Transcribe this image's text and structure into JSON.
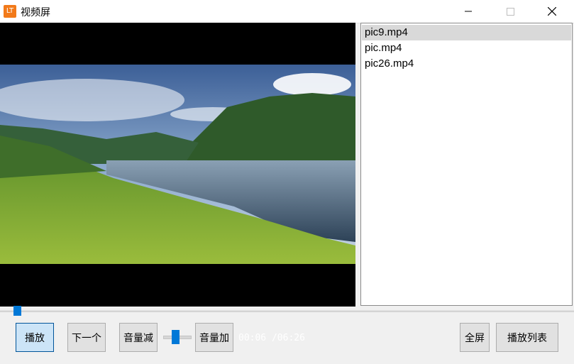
{
  "window": {
    "app_icon_text": "LT",
    "title": "视频屏",
    "controls": [
      "minimize-icon",
      "maximize-icon",
      "close-icon"
    ]
  },
  "playlist": {
    "items": [
      "pic9.mp4",
      "pic.mp4",
      "pic26.mp4"
    ],
    "selected_index": 0
  },
  "controls": {
    "play_label": "播放",
    "next_label": "下一个",
    "vol_down_label": "音量减",
    "vol_up_label": "音量加",
    "time_text": "00:06 /06:26",
    "fullscreen_label": "全屏",
    "playlist_label": "播放列表"
  },
  "colors": {
    "accent": "#0078d7",
    "app_icon": "#f27a1a",
    "video_bg": "#000000"
  }
}
